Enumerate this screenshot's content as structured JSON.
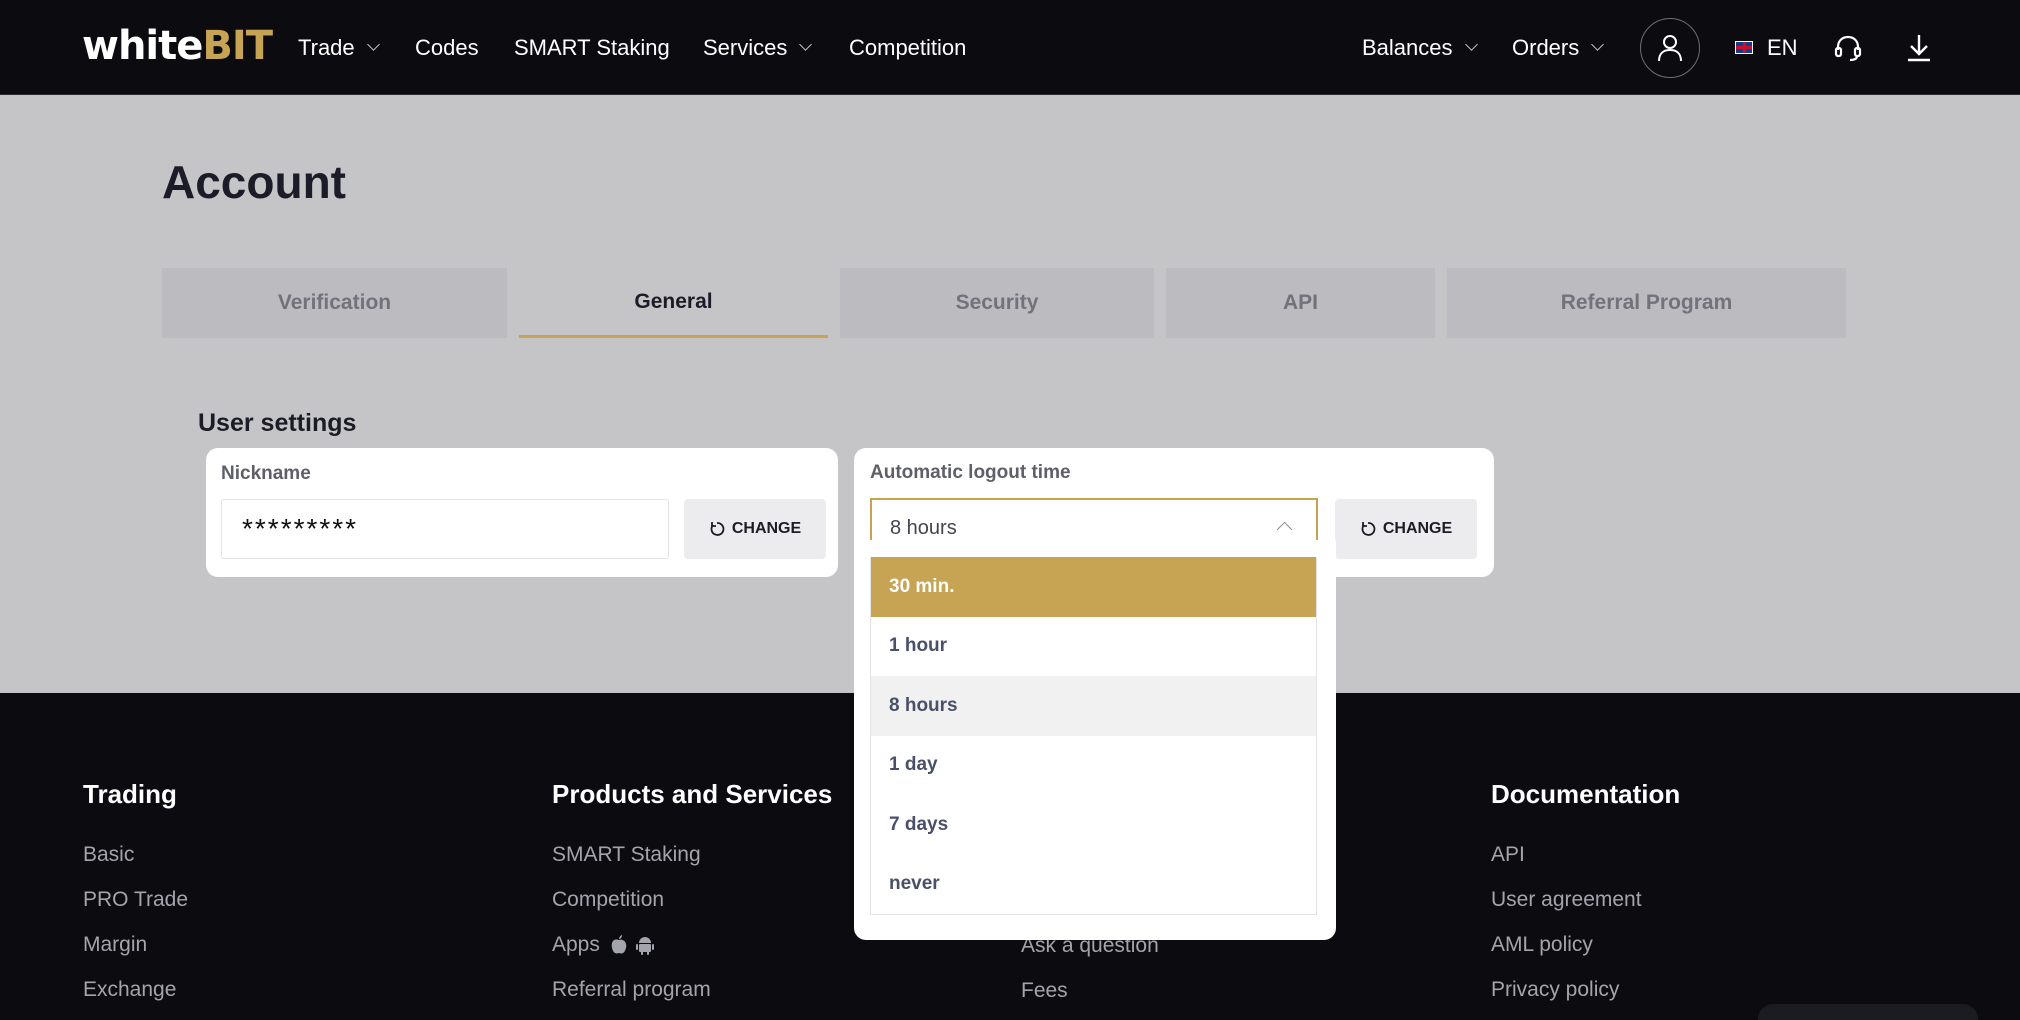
{
  "header": {
    "logo_white": "white",
    "logo_bit": "BIT",
    "nav": [
      {
        "label": "Trade",
        "dropdown": true
      },
      {
        "label": "Codes",
        "dropdown": false
      },
      {
        "label": "SMART Staking",
        "dropdown": false
      },
      {
        "label": "Services",
        "dropdown": true
      },
      {
        "label": "Competition",
        "dropdown": false
      }
    ],
    "right_nav": [
      {
        "label": "Balances",
        "dropdown": true
      },
      {
        "label": "Orders",
        "dropdown": true
      }
    ],
    "language": "EN",
    "icons": [
      "user-icon",
      "flag-uk-icon",
      "headset-icon",
      "download-icon"
    ]
  },
  "page": {
    "title": "Account",
    "tabs": [
      {
        "label": "Verification",
        "active": false
      },
      {
        "label": "General",
        "active": true
      },
      {
        "label": "Security",
        "active": false
      },
      {
        "label": "API",
        "active": false
      },
      {
        "label": "Referral Program",
        "active": false
      }
    ],
    "section_title": "User settings",
    "nickname": {
      "label": "Nickname",
      "value": "*********",
      "button": "CHANGE"
    },
    "logout": {
      "label": "Automatic logout time",
      "value": "8 hours",
      "button": "CHANGE",
      "options": [
        "30 min.",
        "1 hour",
        "8 hours",
        "1 day",
        "7 days",
        "never"
      ],
      "highlighted": "30 min.",
      "selected": "8 hours"
    }
  },
  "footer": {
    "columns": [
      {
        "heading": "Trading",
        "links": [
          "Basic",
          "PRO Trade",
          "Margin",
          "Exchange"
        ]
      },
      {
        "heading": "Products and Services",
        "links": [
          "SMART Staking",
          "Competition",
          "Apps",
          "Referral program"
        ]
      },
      {
        "heading": "",
        "links": [
          "Ask a question",
          "Fees"
        ]
      },
      {
        "heading": "Documentation",
        "links": [
          "API",
          "User agreement",
          "AML policy",
          "Privacy policy"
        ]
      }
    ]
  },
  "colors": {
    "accent": "#c6a453",
    "header_bg": "#0b0b10",
    "main_bg": "#c5c5c8"
  }
}
